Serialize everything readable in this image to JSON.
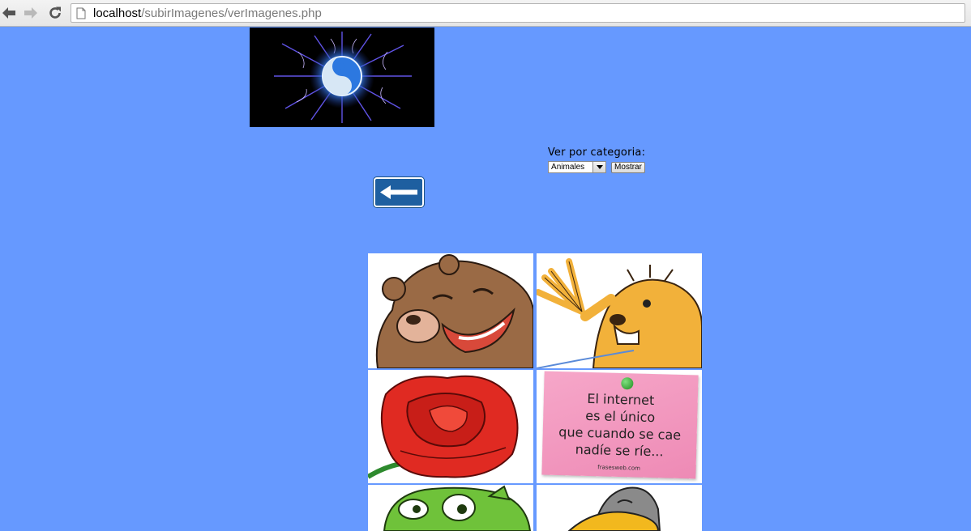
{
  "browser": {
    "url_host": "localhost",
    "url_path": "/subirImagenes/verImagenes.php",
    "icons": [
      "back-arrow-icon",
      "forward-arrow-icon",
      "reload-icon",
      "page-icon"
    ]
  },
  "filter": {
    "label": "Ver por categoria:",
    "selected": "Animales",
    "button": "Mostrar"
  },
  "gallery": {
    "note": {
      "lines": [
        "El internet",
        "es el único",
        "que cuando se cae",
        "nadíe se ríe..."
      ],
      "credit": "frasesweb.com"
    }
  },
  "colors": {
    "page_background": "#6699ff",
    "sign_blue": "#1e5fa0"
  }
}
